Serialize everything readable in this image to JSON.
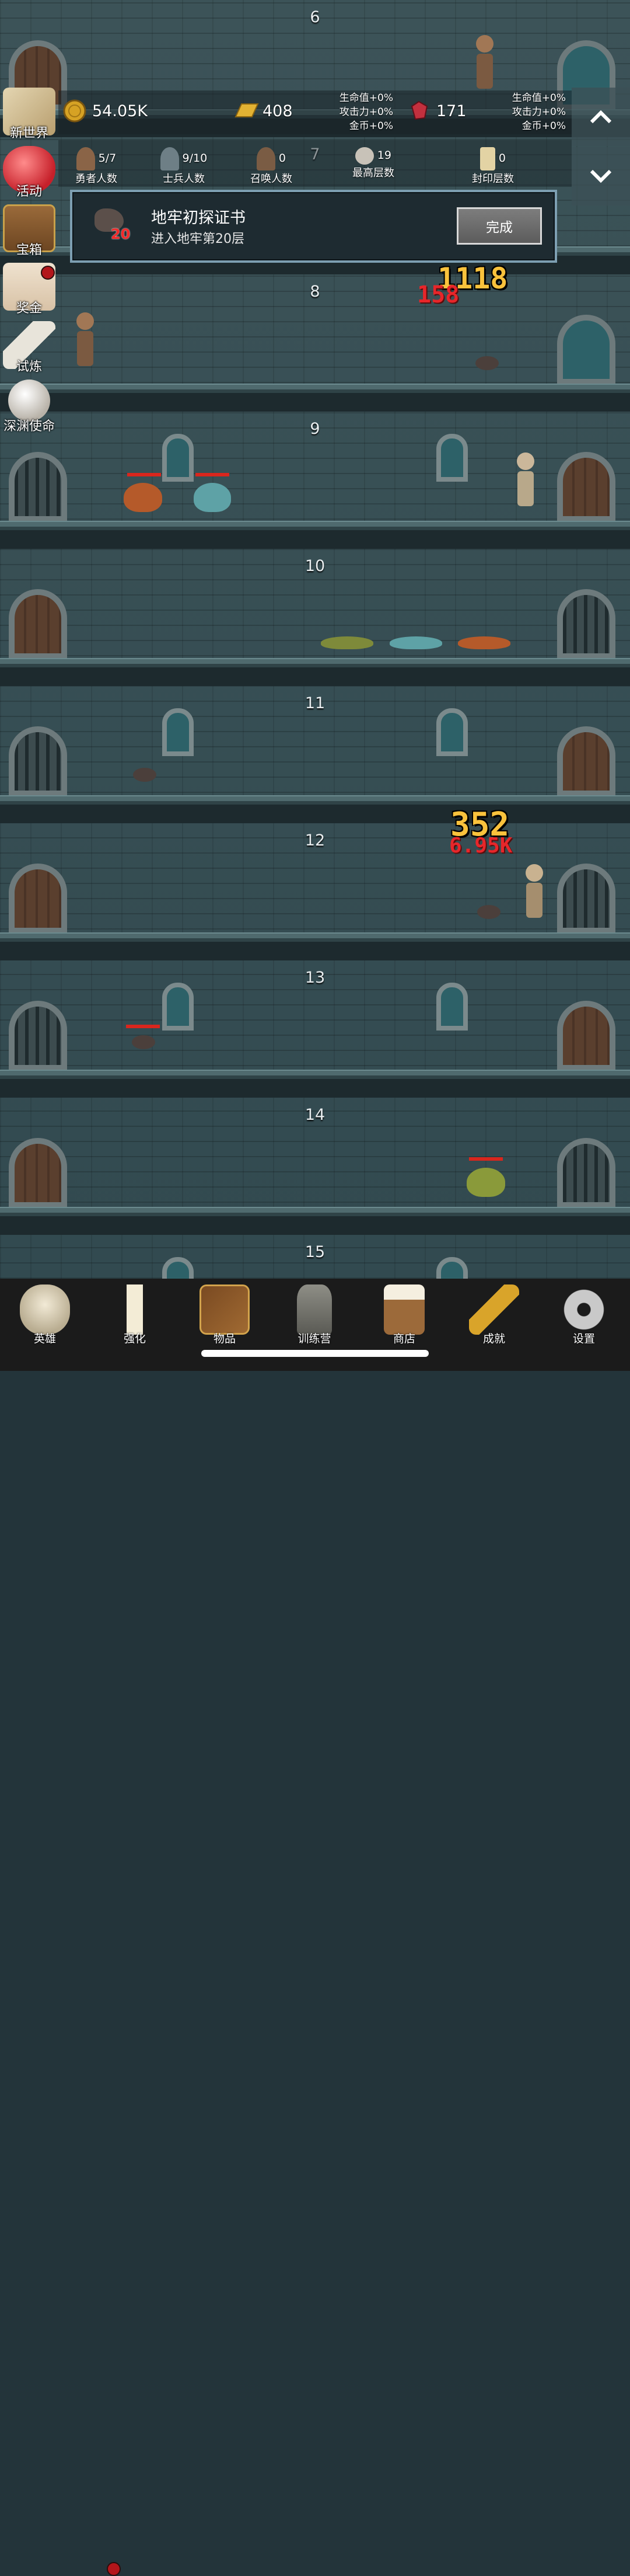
{
  "floors": [
    "6",
    "7",
    "8",
    "9",
    "10",
    "11",
    "12",
    "13",
    "14",
    "15"
  ],
  "resources": {
    "gold": "54.05K",
    "gold_bar": "408",
    "gold_bar_bonus": [
      "生命值+0%",
      "攻击力+0%",
      "金币+0%"
    ],
    "ruby": "171",
    "ruby_bonus": [
      "生命值+0%",
      "攻击力+0%",
      "金币+0%"
    ]
  },
  "stats": [
    {
      "value": "5/7",
      "label": "勇者人数"
    },
    {
      "value": "9/10",
      "label": "士兵人数"
    },
    {
      "value": "0",
      "label": "召唤人数"
    },
    {
      "value": "19",
      "label": "最高层数"
    },
    {
      "value": "0",
      "label": "封印层数"
    }
  ],
  "side_menu": [
    "新世界",
    "活动",
    "宝箱",
    "奖金",
    "试炼",
    "深渊使命"
  ],
  "quest": {
    "badge_number": "20",
    "title": "地牢初探证书",
    "subtitle": "进入地牢第20层",
    "button": "完成"
  },
  "damage": {
    "floor8_gold": "1118",
    "floor8_red": "158",
    "floor12_gold": "352",
    "floor12_red": "6.95K"
  },
  "tabs": [
    "英雄",
    "强化",
    "物品",
    "训练营",
    "商店",
    "成就",
    "设置"
  ],
  "icons": {
    "nav_up": "chevron-up-icon",
    "nav_down": "chevron-down-icon"
  }
}
